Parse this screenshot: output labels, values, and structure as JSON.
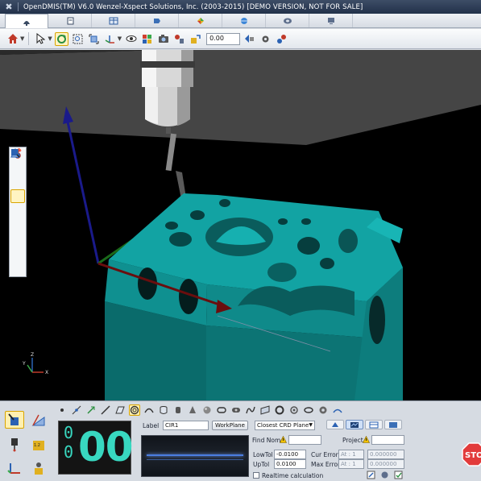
{
  "titlebar": {
    "title": "OpenDMIS(TM) V6.0    Wenzel-Xspect Solutions, Inc. (2003-2015) [DEMO VERSION, NOT FOR SALE]",
    "icon": "app-logo-icon"
  },
  "tabs": [
    {
      "name": "tab-measure",
      "icon": "probe-icon",
      "active": true
    },
    {
      "name": "tab-program",
      "icon": "document-icon",
      "active": false
    },
    {
      "name": "tab-table",
      "icon": "table-icon",
      "active": false
    },
    {
      "name": "tab-report",
      "icon": "report-icon",
      "active": false
    },
    {
      "name": "tab-graphics",
      "icon": "cube-colors-icon",
      "active": false
    },
    {
      "name": "tab-settings",
      "icon": "globe-icon",
      "active": false
    },
    {
      "name": "tab-tools",
      "icon": "tools-icon",
      "active": false
    },
    {
      "name": "tab-help",
      "icon": "monitor-icon",
      "active": false
    }
  ],
  "toolbar": {
    "value": "0.00"
  },
  "colors": {
    "viewport_bg": "#000000",
    "floor": "#3b3b3b",
    "part": "#0f8f8f",
    "accent_select": "#fff0b0",
    "digits": "#38d8c0"
  },
  "counter": {
    "small_top": "0",
    "small_bottom": "0",
    "big": "00"
  },
  "panel": {
    "label_caption": "Label",
    "label_value": "CIR1",
    "workplane_button": "WorkPlane",
    "fit_method": "Closest CRD Plane",
    "find_nom": "Find Nom",
    "project": "Project",
    "lowtol_label": "LowTol",
    "lowtol_value": "-0.0100",
    "uptol_label": "UpTol",
    "uptol_value": "0.0100",
    "cur_error_label": "Cur Error",
    "cur_error_axis": "At : 1",
    "cur_error_value": "0.000000",
    "max_error_label": "Max Error",
    "max_error_axis": "At : 1",
    "max_error_value": "0.000000",
    "realtime_label": "Realtime calculation"
  },
  "overlay": {
    "stop_text": "STO"
  }
}
